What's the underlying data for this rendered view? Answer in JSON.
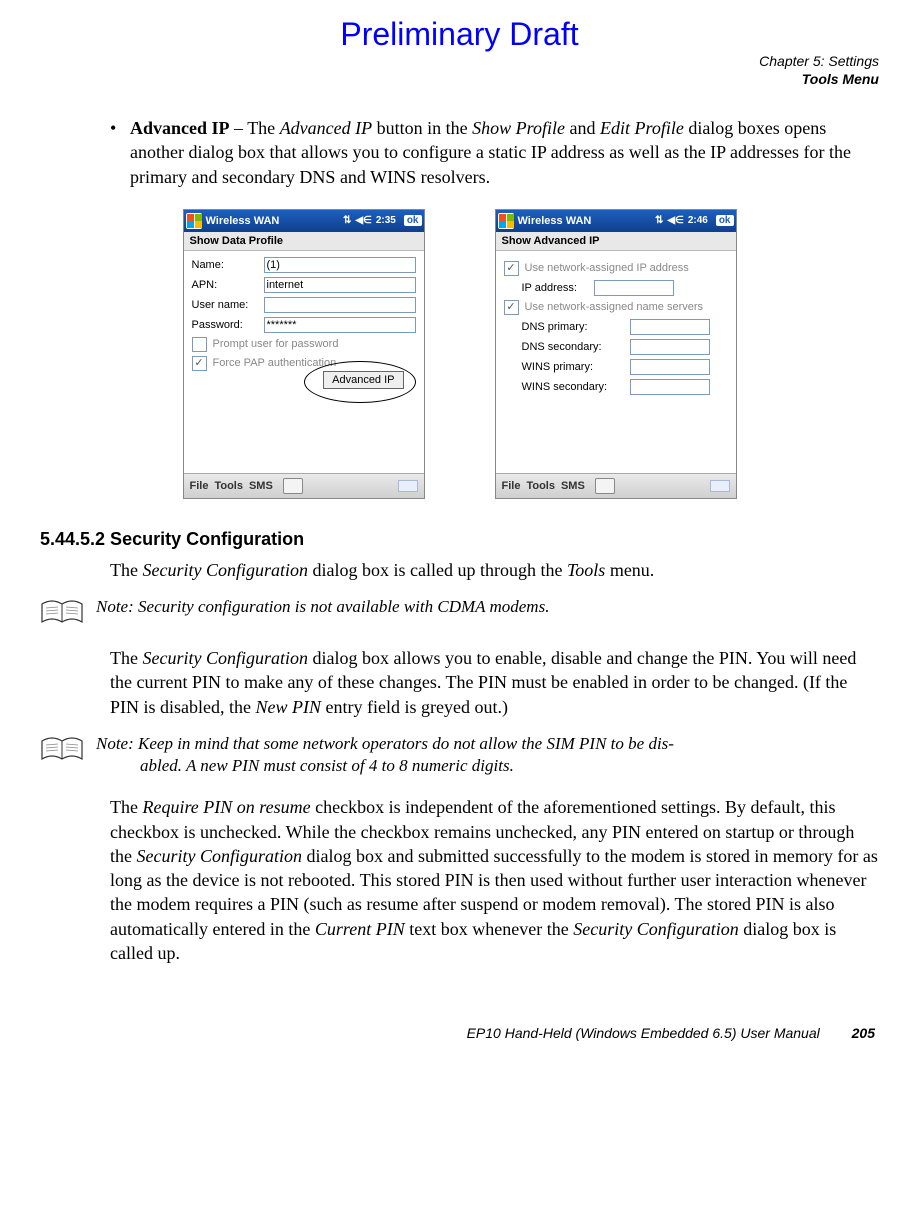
{
  "draft_title": "Preliminary Draft",
  "chapter_header": {
    "line1": "Chapter 5: Settings",
    "line2": "Tools Menu"
  },
  "bullet": {
    "lead_bold": "Advanced IP",
    "dash": " – The ",
    "i1": "Advanced IP",
    "mid1": " button in the ",
    "i2": "Show Profile",
    "mid2": " and ",
    "i3": "Edit Profile",
    "tail": " dialog boxes opens another dialog box that allows you to configure a static IP address as well as the IP addresses for the primary and secondary DNS and WINS resolvers."
  },
  "screen_left": {
    "title": "Wireless WAN",
    "time": "2:35",
    "ok": "ok",
    "subtitle": "Show Data Profile",
    "rows": {
      "name_label": "Name:",
      "name_value": "(1)",
      "apn_label": "APN:",
      "apn_value": "internet",
      "user_label": "User name:",
      "user_value": "",
      "pass_label": "Password:",
      "pass_value": "*******"
    },
    "check1": "Prompt user for password",
    "check2": "Force PAP authentication",
    "adv_button": "Advanced IP",
    "menubar": {
      "file": "File",
      "tools": "Tools",
      "sms": "SMS"
    }
  },
  "screen_right": {
    "title": "Wireless WAN",
    "time": "2:46",
    "ok": "ok",
    "subtitle": "Show Advanced IP",
    "check1": "Use network-assigned IP address",
    "ip_label": "IP address:",
    "check2": "Use network-assigned name servers",
    "dns1_label": "DNS primary:",
    "dns2_label": "DNS secondary:",
    "wins1_label": "WINS primary:",
    "wins2_label": "WINS secondary:",
    "menubar": {
      "file": "File",
      "tools": "Tools",
      "sms": "SMS"
    }
  },
  "section_heading": "5.44.5.2 Security Configuration",
  "para1": {
    "pre": "The ",
    "i1": "Security Configuration",
    "mid": " dialog box is called up through the ",
    "i2": "Tools",
    "post": " menu."
  },
  "note1": "Note: Security configuration is not available with CDMA modems.",
  "para2": {
    "pre": "The ",
    "i1": "Security Configuration",
    "mid": " dialog box allows you to enable, disable and change the PIN. You will need the current PIN to make any of these changes. The PIN must be enabled in order to be changed. (If the PIN is disabled, the ",
    "i2": "New PIN",
    "post": " entry field is greyed out.)"
  },
  "note2": {
    "line1": "Note: Keep in mind that some network operators do not allow the SIM PIN to be dis-",
    "line2": "abled. A new PIN must consist of 4 to 8 numeric digits."
  },
  "para3": {
    "pre": "The ",
    "i1": "Require PIN on resume",
    "mid1": " checkbox is independent of the aforementioned settings. By default, this checkbox is unchecked. While the checkbox remains unchecked, any PIN entered on startup or through the ",
    "i2": "Security Configuration",
    "mid2": " dialog box and submitted successfully to the modem is stored in memory for as long as the device is not rebooted. This stored PIN is then used without further user interaction whenever the modem requires a PIN (such as resume after suspend or modem removal). The stored PIN is also automatically entered in the ",
    "i3": "Current PIN",
    "mid3": " text box whenever the ",
    "i4": "Security Configuration",
    "post": " dialog box is called up."
  },
  "footer": {
    "manual": "EP10 Hand-Held (Windows Embedded 6.5) User Manual",
    "page": "205"
  }
}
